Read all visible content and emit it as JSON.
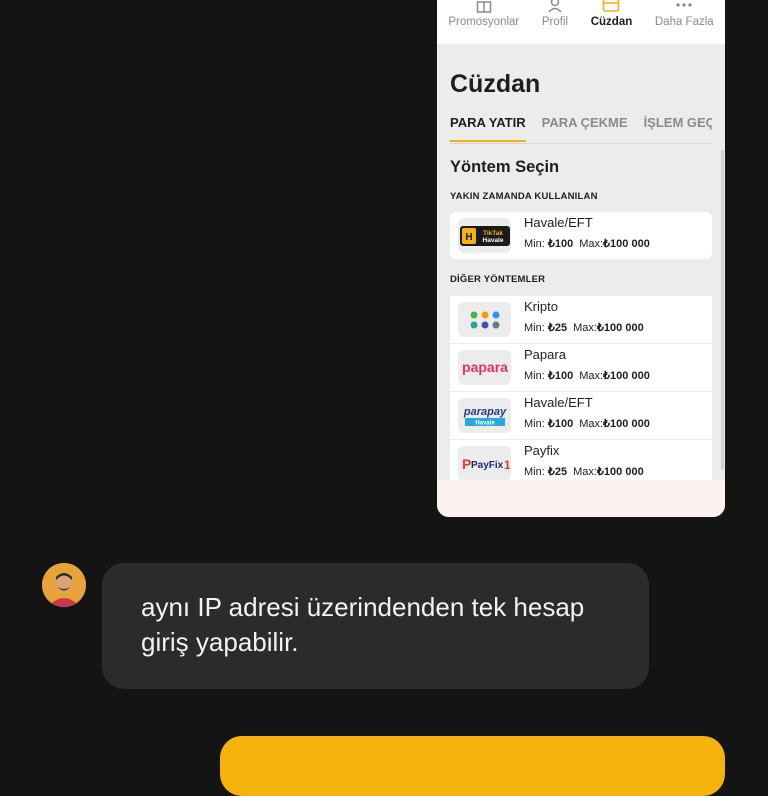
{
  "phone": {
    "nav": [
      {
        "label": "Promosyonlar",
        "icon": "gift-icon",
        "active": false
      },
      {
        "label": "Profil",
        "icon": "user-icon",
        "active": false
      },
      {
        "label": "Cüzdan",
        "icon": "wallet-icon",
        "active": true
      },
      {
        "label": "Daha Fazla",
        "icon": "more-dots-icon",
        "active": false
      }
    ],
    "title": "Cüzdan",
    "tabs": [
      "PARA YATIR",
      "PARA ÇEKME",
      "İŞLEM GEÇMİŞİ"
    ],
    "section_title": "Yöntem Seçin",
    "recent_label": "YAKIN ZAMANDA KULLANILAN",
    "other_label": "DİĞER YÖNTEMLER",
    "min_label": "Min:",
    "max_label": "Max:",
    "recent": [
      {
        "name": "Havale/EFT",
        "min": "₺100",
        "max": "₺100 000",
        "logo_text": "TikTak Havale",
        "logo": "tiktak-havale-logo"
      }
    ],
    "others": [
      {
        "name": "Kripto",
        "min": "₺25",
        "max": "₺100 000",
        "logo": "crypto-logo"
      },
      {
        "name": "Papara",
        "min": "₺100",
        "max": "₺100 000",
        "logo_text": "papara",
        "logo": "papara-logo"
      },
      {
        "name": "Havale/EFT",
        "min": "₺100",
        "max": "₺100 000",
        "logo_text": "parapay",
        "logo_sub": "Havale",
        "logo": "parapay-logo"
      },
      {
        "name": "Payfix",
        "min": "₺25",
        "max": "₺100 000",
        "logo_text": "PayFix",
        "logo": "payfix-logo"
      }
    ],
    "accent": "#f6b012"
  },
  "chat": {
    "message": "aynı IP adresi üzerindenden tek hesap giriş yapabilir.",
    "bubble_color": "#2b2b2b",
    "own_bubble_color": "#f6b30e"
  }
}
